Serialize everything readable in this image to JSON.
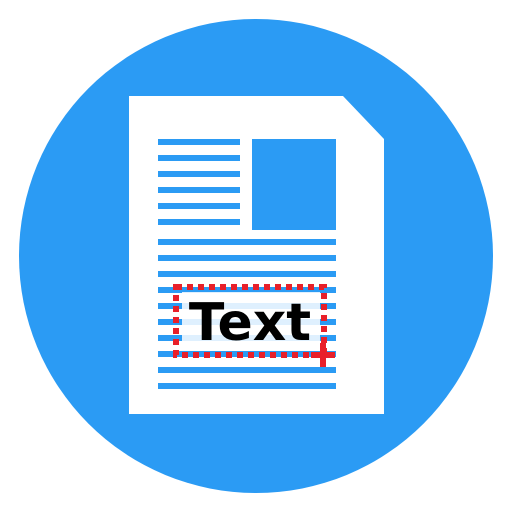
{
  "icon": {
    "name": "text-extraction-app-icon",
    "selection_text": "Text",
    "colors": {
      "circle": "#2B9BF4",
      "page": "#FFFFFF",
      "lines": "#2B9BF4",
      "image_block": "#2B9BF4",
      "selection": "#E8202A",
      "text": "#000000"
    }
  }
}
